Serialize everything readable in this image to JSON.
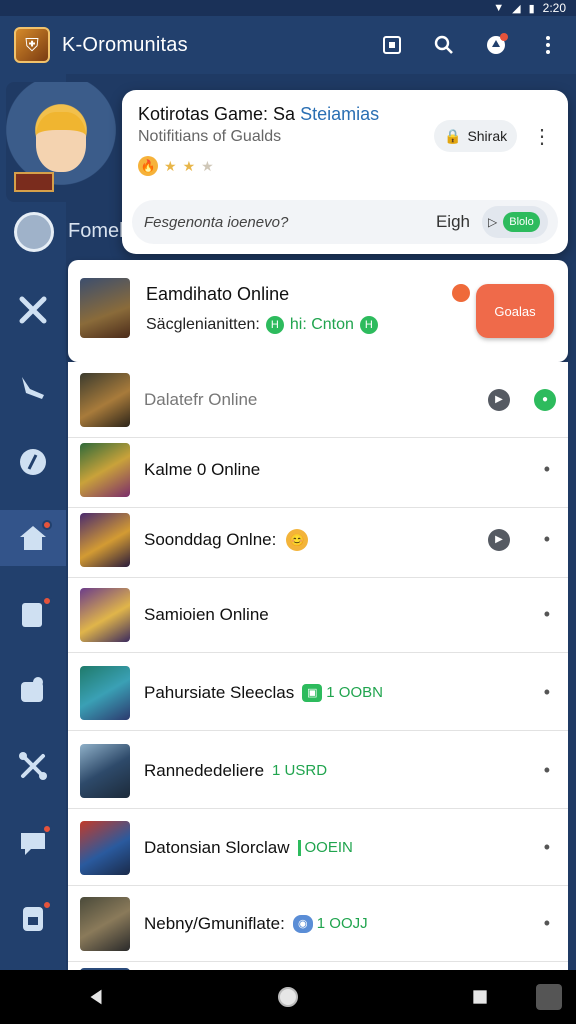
{
  "status": {
    "time": "2:20",
    "icons": [
      "wifi-icon",
      "signal-icon",
      "battery-icon"
    ]
  },
  "appbar": {
    "title": "K-Oromunitas",
    "actions": [
      "grid-icon",
      "search-icon",
      "notifications-icon",
      "more-vert-icon"
    ]
  },
  "sidebar": {
    "profile_name": "Fomel",
    "items": [
      {
        "icon": "crossed-swords-icon",
        "badge": false
      },
      {
        "icon": "horn-icon",
        "badge": false
      },
      {
        "icon": "compass-icon",
        "badge": false
      },
      {
        "icon": "home-icon",
        "badge": true,
        "active": true
      },
      {
        "icon": "card-icon",
        "badge": true
      },
      {
        "icon": "puzzle-icon",
        "badge": false
      },
      {
        "icon": "tools-icon",
        "badge": true
      },
      {
        "icon": "chat-icon",
        "badge": true
      },
      {
        "icon": "clipboard-icon",
        "badge": true
      }
    ]
  },
  "popover": {
    "title_main": "Kotirotas Game: Sa ",
    "title_accent": "Steiamias",
    "subtitle": "Notifitians of Gualds",
    "rating_stars": 3,
    "rating_filled": 2,
    "share_label": "Shirak",
    "search_placeholder": "Fesgenonta ioenevo?",
    "search_value": "Eigh",
    "toggle_label": "Blolo"
  },
  "featured": {
    "title": "Eamdihato Online",
    "subtitle_text": "Säcglenianitten:",
    "subtitle_green": "hi: Cnton",
    "button_label": "Goalas"
  },
  "games": [
    {
      "title": "Dalatefr Online",
      "muted": true,
      "badge": "",
      "play": true,
      "gcircle": true
    },
    {
      "title": "Kalme 0 Online",
      "muted": false,
      "badge": ""
    },
    {
      "title": "Soonddag Onlne:",
      "muted": false,
      "badge": "",
      "emoji": true,
      "play": true
    },
    {
      "title": "Samioien Online",
      "muted": false,
      "badge": ""
    },
    {
      "title": "Pahursiate Sleeclas",
      "muted": false,
      "badge": "1 OOBN",
      "badge_style": "box"
    },
    {
      "title": "Rannededeliere",
      "muted": false,
      "badge": "1 USRD",
      "badge_style": "none"
    },
    {
      "title": "Datonsian Slorclaw",
      "muted": false,
      "badge": "OOEIN",
      "badge_style": "bar"
    },
    {
      "title": "Nebny/Gmuniflate:",
      "muted": false,
      "badge": "1 OOJJ",
      "badge_style": "bbox"
    }
  ],
  "nav": [
    "back-icon",
    "home-circle-icon",
    "recents-icon"
  ]
}
